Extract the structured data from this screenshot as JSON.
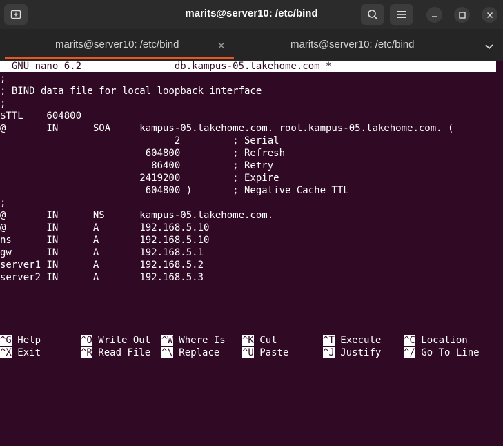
{
  "window": {
    "title": "marits@server10: /etc/bind"
  },
  "tabs": [
    {
      "label": "marits@server10: /etc/bind",
      "active": true,
      "close": "×"
    },
    {
      "label": "marits@server10: /etc/bind",
      "active": false
    }
  ],
  "icons": {
    "new_tab": "new-tab-icon",
    "search": "search-icon",
    "menu": "hamburger-menu-icon",
    "minimize": "minimize-icon",
    "maximize": "maximize-icon",
    "close": "close-icon",
    "tab_dropdown": "chevron-down-icon"
  },
  "colors": {
    "terminal_bg": "#300a24",
    "accent": "#e95420",
    "titlebar_bg": "#2b2b2b"
  },
  "nano": {
    "header": "  GNU nano 6.2                db.kampus-05.takehome.com *",
    "lines": [
      ";",
      "; BIND data file for local loopback interface",
      ";",
      "$TTL    604800",
      "@       IN      SOA     kampus-05.takehome.com. root.kampus-05.takehome.com. (",
      "                              2         ; Serial",
      "                         604800         ; Refresh",
      "                          86400         ; Retry",
      "                        2419200         ; Expire",
      "                         604800 )       ; Negative Cache TTL",
      ";",
      "@       IN      NS      kampus-05.takehome.com.",
      "@       IN      A       192.168.5.10",
      "ns      IN      A       192.168.5.10",
      "gw      IN      A       192.168.5.1",
      "server1 IN      A       192.168.5.2",
      "server2 IN      A       192.168.5.3"
    ],
    "shortcuts_row1": [
      {
        "key": "^G",
        "label": "Help"
      },
      {
        "key": "^O",
        "label": "Write Out"
      },
      {
        "key": "^W",
        "label": "Where Is"
      },
      {
        "key": "^K",
        "label": "Cut"
      },
      {
        "key": "^T",
        "label": "Execute"
      },
      {
        "key": "^C",
        "label": "Location"
      }
    ],
    "shortcuts_row2": [
      {
        "key": "^X",
        "label": "Exit"
      },
      {
        "key": "^R",
        "label": "Read File"
      },
      {
        "key": "^\\",
        "label": "Replace"
      },
      {
        "key": "^U",
        "label": "Paste"
      },
      {
        "key": "^J",
        "label": "Justify"
      },
      {
        "key": "^/",
        "label": "Go To Line"
      }
    ]
  }
}
